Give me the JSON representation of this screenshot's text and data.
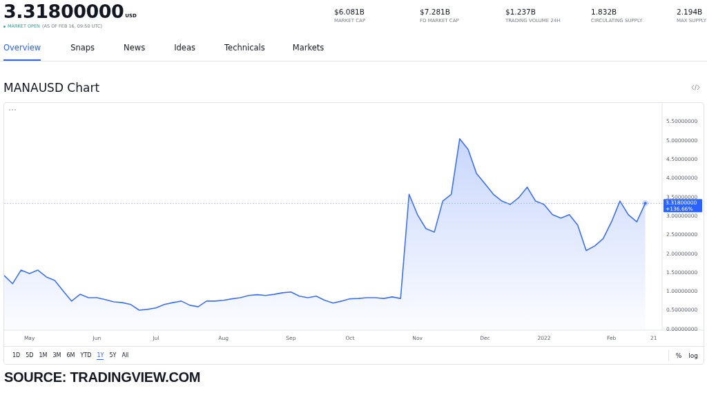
{
  "header": {
    "price": "3.31800000",
    "currency": "USD",
    "status": "MARKET OPEN",
    "status_time": "(AS OF FEB 16, 09:50 UTC)",
    "market_open": true,
    "stats": [
      {
        "value": "$6.081B",
        "label": "MARKET CAP"
      },
      {
        "value": "$7.281B",
        "label": "FD MARKET CAP"
      },
      {
        "value": "$1.237B",
        "label": "TRADING VOLUME 24H"
      },
      {
        "value": "1.832B",
        "label": "CIRCULATING SUPPLY"
      },
      {
        "value": "2.194B",
        "label": "MAX SUPPLY"
      }
    ]
  },
  "tabs": [
    {
      "label": "Overview",
      "selected": true
    },
    {
      "label": "Snaps",
      "selected": false
    },
    {
      "label": "News",
      "selected": false
    },
    {
      "label": "Ideas",
      "selected": false
    },
    {
      "label": "Technicals",
      "selected": false
    },
    {
      "label": "Markets",
      "selected": false
    }
  ],
  "chart_section": {
    "title": "MANAUSD Chart",
    "last_price_label": "3.31800000",
    "change_label": "+136.66%",
    "chart_data": {
      "type": "area",
      "categories": [
        null,
        null,
        null,
        "May",
        null,
        null,
        null,
        null,
        null,
        null,
        null,
        "Jun",
        null,
        null,
        null,
        null,
        null,
        null,
        "Jul",
        null,
        null,
        null,
        null,
        null,
        null,
        null,
        "Aug",
        null,
        null,
        null,
        null,
        null,
        null,
        null,
        "Sep",
        null,
        null,
        null,
        null,
        null,
        null,
        "Oct",
        null,
        null,
        null,
        null,
        null,
        null,
        null,
        "Nov",
        null,
        null,
        null,
        null,
        null,
        null,
        null,
        "Dec",
        null,
        null,
        null,
        null,
        null,
        null,
        "2022",
        null,
        null,
        null,
        null,
        null,
        null,
        null,
        "Feb",
        null,
        null,
        null,
        null,
        "21"
      ],
      "series": [
        {
          "color": "#3b6ff5",
          "values": [
            1.41,
            1.19,
            1.55,
            1.46,
            1.55,
            1.37,
            1.28,
            1.0,
            0.73,
            0.91,
            0.82,
            0.82,
            0.77,
            0.71,
            0.69,
            0.64,
            0.49,
            0.51,
            0.55,
            0.64,
            0.69,
            0.73,
            0.62,
            0.58,
            0.73,
            0.73,
            0.75,
            0.79,
            0.82,
            0.88,
            0.9,
            0.88,
            0.91,
            0.95,
            0.97,
            0.86,
            0.82,
            0.86,
            0.75,
            0.68,
            0.73,
            0.79,
            0.8,
            0.82,
            0.82,
            0.8,
            0.84,
            0.8,
            3.56,
            3.02,
            2.65,
            2.56,
            3.38,
            3.56,
            5.03,
            4.75,
            4.11,
            3.84,
            3.56,
            3.38,
            3.29,
            3.47,
            3.75,
            3.38,
            3.29,
            3.02,
            2.93,
            3.02,
            2.74,
            2.07,
            2.19,
            2.38,
            2.83,
            3.38,
            3.02,
            2.83,
            3.32,
            null
          ]
        }
      ],
      "ylim": [
        -0.04,
        5.98
      ],
      "ref_lines": [
        {
          "axis": "y",
          "value": 3.32
        }
      ],
      "yticks": [
        {
          "value": 0,
          "label": "0.00000000"
        },
        {
          "value": 0.5,
          "label": "0.50000000"
        },
        {
          "value": 1,
          "label": "1.00000000"
        },
        {
          "value": 1.5,
          "label": "1.50000000"
        },
        {
          "value": 2,
          "label": "2.00000000"
        },
        {
          "value": 2.5,
          "label": "2.50000000"
        },
        {
          "value": 3,
          "label": "3.00000000"
        },
        {
          "value": 3.5,
          "label": "3.50000000"
        },
        {
          "value": 4,
          "label": "4.00000000"
        },
        {
          "value": 4.5,
          "label": "4.50000000"
        },
        {
          "value": 5,
          "label": "5.00000000"
        },
        {
          "value": 5.5,
          "label": "5.50000000"
        }
      ]
    },
    "ranges": [
      {
        "label": "1D",
        "selected": false
      },
      {
        "label": "5D",
        "selected": false
      },
      {
        "label": "1M",
        "selected": false
      },
      {
        "label": "3M",
        "selected": false
      },
      {
        "label": "6M",
        "selected": false
      },
      {
        "label": "YTD",
        "selected": false
      },
      {
        "label": "1Y",
        "selected": true
      },
      {
        "label": "5Y",
        "selected": false
      },
      {
        "label": "All",
        "selected": false
      }
    ],
    "scale_options": [
      "%",
      "log"
    ]
  },
  "source": "SOURCE: TRADINGVIEW.COM"
}
